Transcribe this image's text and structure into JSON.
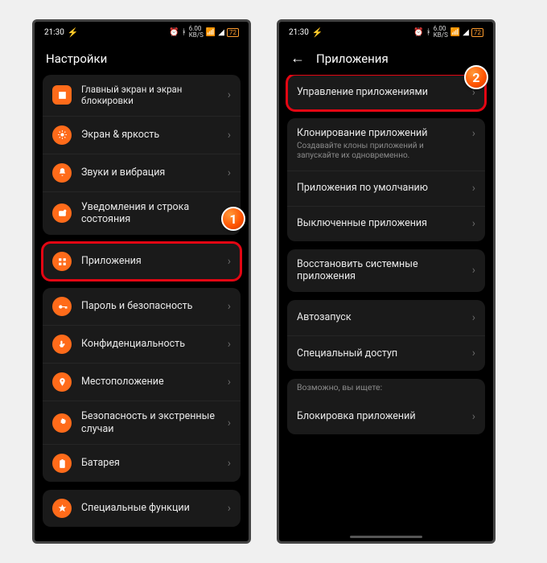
{
  "status": {
    "time": "21:30",
    "net_up": "6.00",
    "net_unit": "KB/S",
    "battery": "72"
  },
  "screen1": {
    "title": "Настройки",
    "items": {
      "lock": "Главный экран и экран блокировки",
      "display": "Экран & яркость",
      "sound": "Звуки и вибрация",
      "notif": "Уведомления и строка состояния",
      "apps": "Приложения",
      "password": "Пароль и безопасность",
      "privacy": "Конфиденциальность",
      "location": "Местоположение",
      "security": "Безопасность и экстренные случаи",
      "battery": "Батарея",
      "special": "Специальные функции"
    },
    "step": "1"
  },
  "screen2": {
    "title": "Приложения",
    "items": {
      "manage": "Управление приложениями",
      "clone": "Клонирование приложений",
      "clone_sub": "Создавайте клоны приложений и запускайте их одновременно.",
      "default": "Приложения по умолчанию",
      "disabled": "Выключенные приложения",
      "restore": "Восстановить системные приложения",
      "autostart": "Автозапуск",
      "specaccess": "Специальный доступ",
      "hint": "Возможно, вы ищете:",
      "applock": "Блокировка приложений"
    },
    "step": "2"
  }
}
